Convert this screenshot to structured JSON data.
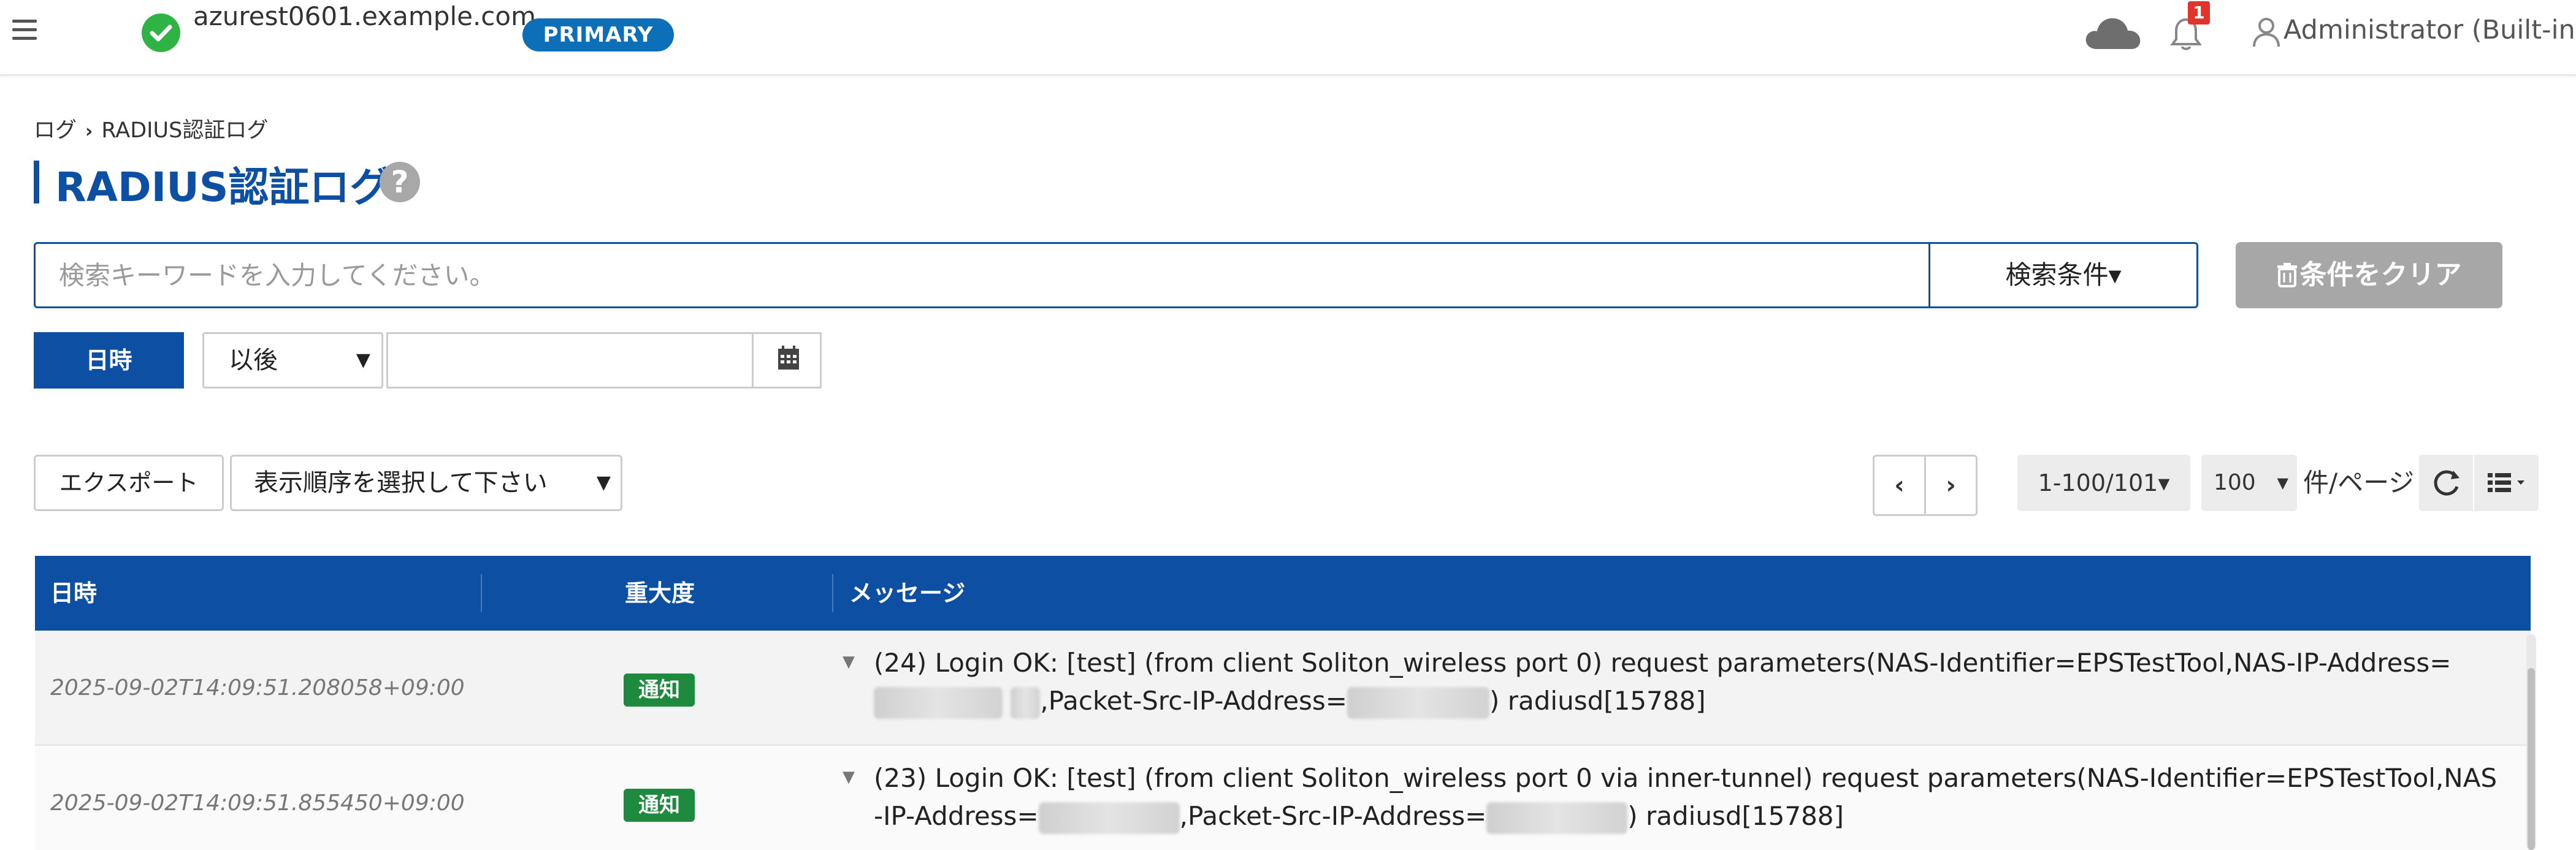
{
  "header": {
    "hostname": "azurest0601.example.com",
    "badge": "PRIMARY",
    "notification_count": "1",
    "user": "Administrator (Built-in)"
  },
  "breadcrumb": {
    "root": "ログ",
    "current": "RADIUS認証ログ"
  },
  "page": {
    "title": "RADIUS認証ログ",
    "help": "?"
  },
  "search": {
    "placeholder": "検索キーワードを入力してください。",
    "conditions_label": "検索条件▾",
    "clear_label": "条件をクリア"
  },
  "date_filter": {
    "label": "日時",
    "operator": "以後",
    "value": ""
  },
  "toolbar": {
    "export_label": "エクスポート",
    "sort_placeholder": "表示順序を選択して下さい",
    "range_label": "1-100/101▾",
    "per_page": "100",
    "per_page_unit": "件/ページ"
  },
  "table": {
    "columns": [
      "日時",
      "重大度",
      "メッセージ"
    ],
    "rows": [
      {
        "date": "2025-09-02T14:09:51.208058+09:00",
        "severity": "通知",
        "msg_part1": "(24) Login OK: [test] (from client Soliton_wireless port 0) request parameters(NAS-Identifier=EPSTestTool,NAS-IP-Address=",
        "msg_part2": ",Packet-Src-IP-Address=",
        "msg_part3": ")  radiusd[15788]"
      },
      {
        "date": "2025-09-02T14:09:51.855450+09:00",
        "severity": "通知",
        "msg_part1": "(23) Login OK: [test] (from client Soliton_wireless port 0 via inner-tunnel) request parameters(NAS-Identifier=EPSTestTool,NAS-IP-Address=",
        "msg_part2": ",Packet-Src-IP-Address=",
        "msg_part3": ")  radiusd[15788]"
      }
    ]
  },
  "colors": {
    "brand": "#0d4fa3",
    "badge": "#0d6fb8",
    "success": "#2fb344",
    "severity_notice": "#1e8a3e",
    "alert": "#e0342c"
  }
}
